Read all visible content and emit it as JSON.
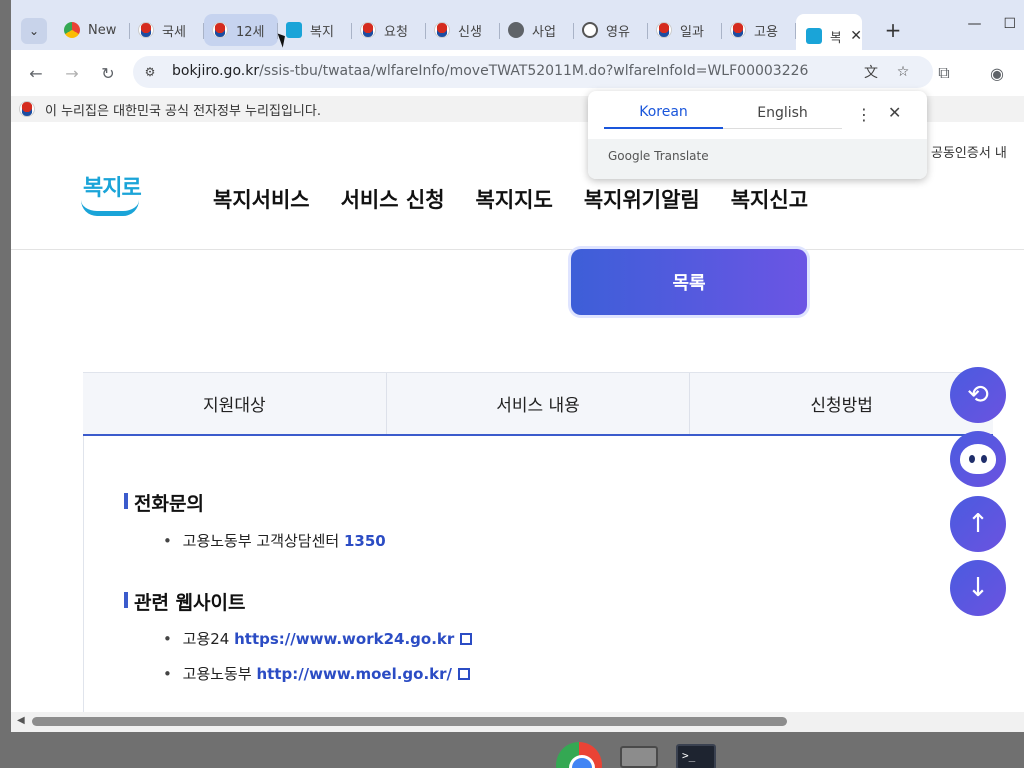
{
  "browser": {
    "tabs": [
      {
        "title": "New",
        "favicon": "chrome-icon"
      },
      {
        "title": "국세",
        "favicon": "flag-icon"
      },
      {
        "title": "12세",
        "favicon": "flag-icon"
      },
      {
        "title": "복지",
        "favicon": "bokjiro-icon"
      },
      {
        "title": "요청",
        "favicon": "flag-icon"
      },
      {
        "title": "신생",
        "favicon": "flag-icon"
      },
      {
        "title": "사업",
        "favicon": "globe-icon"
      },
      {
        "title": "영유",
        "favicon": "ret-icon"
      },
      {
        "title": "일과",
        "favicon": "flag-icon"
      },
      {
        "title": "고용",
        "favicon": "flag-icon"
      },
      {
        "title": "복",
        "favicon": "bokjiro-icon"
      }
    ],
    "new_tab": "+",
    "url_host": "bokjiro.go.kr",
    "url_path": "/ssis-tbu/twataa/wlfareInfo/moveTWAT52011M.do?wlfareInfoId=WLF00003226"
  },
  "gov_bar": {
    "text": "이 누리집은 대한민국 공식 전자정부 누리집입니다."
  },
  "site": {
    "logo_text": "복지로",
    "nav": [
      "복지서비스",
      "서비스 신청",
      "복지지도",
      "복지위기알림",
      "복지신고"
    ],
    "util_link": "공동인증서 내"
  },
  "content": {
    "list_button": "목록",
    "info_tabs": [
      "지원대상",
      "서비스 내용",
      "신청방법"
    ],
    "sections": {
      "phone": {
        "title": "전화문의",
        "item_label": "고용노동부 고객상담센터",
        "item_value": "1350"
      },
      "websites": {
        "title": "관련 웹사이트",
        "items": [
          {
            "label": "고용24",
            "url": "https://www.work24.go.kr"
          },
          {
            "label": "고용노동부",
            "url": "http://www.moel.go.kr/"
          }
        ]
      }
    }
  },
  "translate_popup": {
    "tab_source": "Korean",
    "tab_target": "English",
    "brand": "Google Translate"
  },
  "taskbar": {
    "terminal_label": ">_"
  }
}
